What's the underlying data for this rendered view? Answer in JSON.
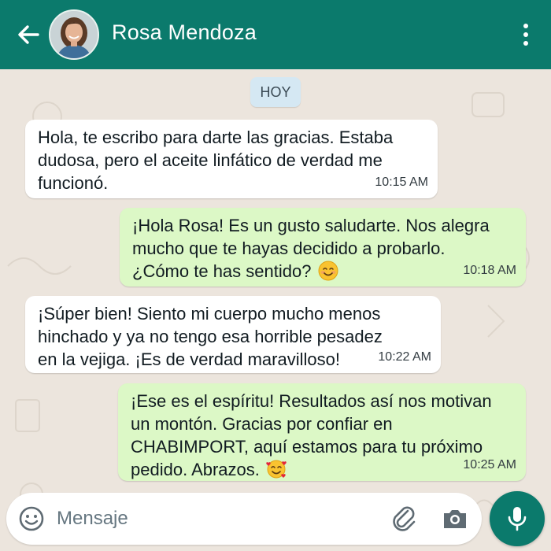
{
  "header": {
    "contact_name": "Rosa Mendoza",
    "back_icon": "arrow-left-icon",
    "menu_icon": "more-vertical-icon",
    "bar_color": "#0b7a6c"
  },
  "chat": {
    "date_label": "HOY",
    "messages": [
      {
        "direction": "in",
        "lines": [
          "Hola, te escribo para darte las gracias. Estaba",
          "dudosa, pero el aceite linfático de verdad me",
          "funcionó."
        ],
        "time": "10:15 AM"
      },
      {
        "direction": "out",
        "lines": [
          "¡Hola Rosa! Es un gusto saludarte. Nos alegra",
          "mucho que te hayas decidido a probarlo.",
          "¿Cómo te has sentido?"
        ],
        "emoji": "smiling-face-emoji",
        "time": "10:18 AM"
      },
      {
        "direction": "in",
        "lines": [
          "¡Súper bien! Siento mi cuerpo mucho menos",
          "hinchado y ya no tengo esa horrible pesadez",
          "en la vejiga. ¡Es de verdad maravilloso!"
        ],
        "time": "10:22 AM"
      },
      {
        "direction": "out",
        "lines": [
          "¡Ese es el espíritu! Resultados así nos motivan",
          "un montón. Gracias por confiar en",
          "CHABIMPORT, aquí estamos para tu próximo",
          "pedido. Abrazos."
        ],
        "emoji": "smiling-face-with-hearts-emoji",
        "time": "10:25 AM"
      }
    ],
    "incoming_color": "#ffffff",
    "outgoing_color": "#dcf8c6"
  },
  "composer": {
    "placeholder": "Mensaje",
    "value": "",
    "emoji_icon": "emoji-icon",
    "attach_icon": "paperclip-icon",
    "camera_icon": "camera-icon",
    "mic_icon": "microphone-icon"
  }
}
